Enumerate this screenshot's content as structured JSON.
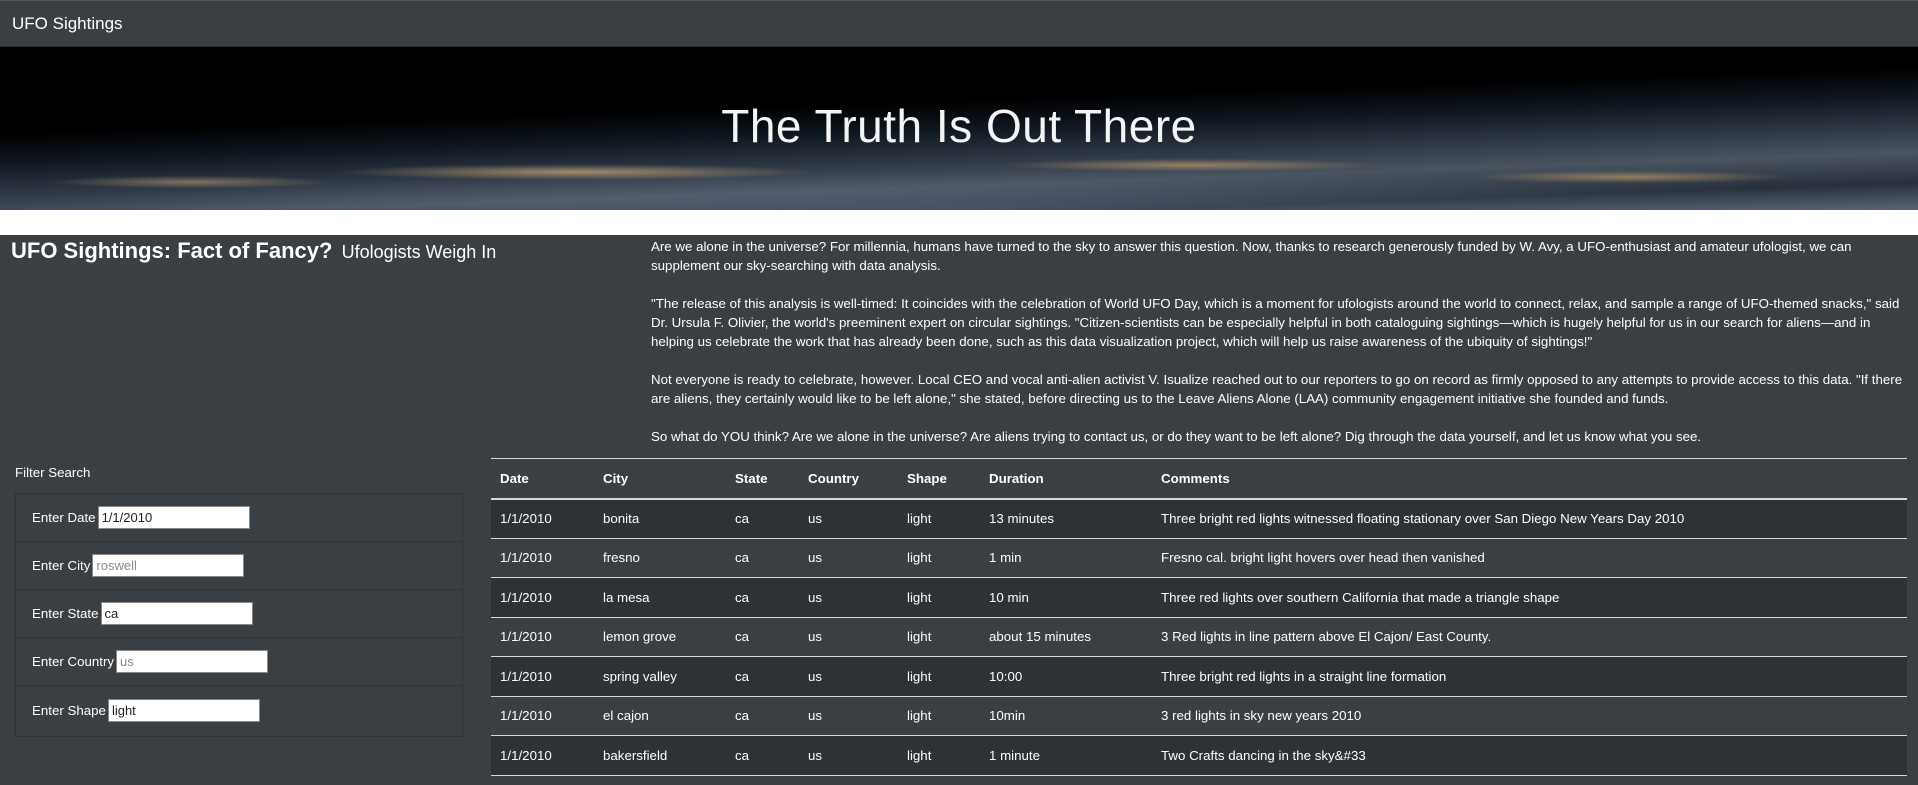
{
  "navbar": {
    "brand": "UFO Sightings"
  },
  "hero": {
    "title": "The Truth Is Out There"
  },
  "intro": {
    "heading": "UFO Sightings: Fact of Fancy?",
    "subheading": "Ufologists Weigh In",
    "paragraphs": [
      "Are we alone in the universe? For millennia, humans have turned to the sky to answer this question. Now, thanks to research generously funded by W. Avy, a UFO-enthusiast and amateur ufologist, we can supplement our sky-searching with data analysis.",
      "\"The release of this analysis is well-timed: It coincides with the celebration of World UFO Day, which is a moment for ufologists around the world to connect, relax, and sample a range of UFO-themed snacks,\" said Dr. Ursula F. Olivier, the world's preeminent expert on circular sightings. \"Citizen-scientists can be especially helpful in both cataloguing sightings—which is hugely helpful for us in our search for aliens—and in helping us celebrate the work that has already been done, such as this data visualization project, which will help us raise awareness of the ubiquity of sightings!\"",
      "Not everyone is ready to celebrate, however. Local CEO and vocal anti-alien activist V. Isualize reached out to our reporters to go on record as firmly opposed to any attempts to provide access to this data. \"If there are aliens, they certainly would like to be left alone,\" she stated, before directing us to the Leave Aliens Alone (LAA) community engagement initiative she founded and funds.",
      "So what do YOU think? Are we alone in the universe? Are aliens trying to contact us, or do they want to be left alone? Dig through the data yourself, and let us know what you see."
    ]
  },
  "filters": {
    "title": "Filter Search",
    "fields": [
      {
        "label": "Enter Date",
        "value": "1/1/2010",
        "placeholder": ""
      },
      {
        "label": "Enter City",
        "value": "",
        "placeholder": "roswell"
      },
      {
        "label": "Enter State",
        "value": "ca",
        "placeholder": ""
      },
      {
        "label": "Enter Country",
        "value": "",
        "placeholder": "us"
      },
      {
        "label": "Enter Shape",
        "value": "light",
        "placeholder": ""
      }
    ]
  },
  "table": {
    "columns": [
      "Date",
      "City",
      "State",
      "Country",
      "Shape",
      "Duration",
      "Comments"
    ],
    "rows": [
      [
        "1/1/2010",
        "bonita",
        "ca",
        "us",
        "light",
        "13 minutes",
        "Three bright red lights witnessed floating stationary over San Diego New Years Day 2010"
      ],
      [
        "1/1/2010",
        "fresno",
        "ca",
        "us",
        "light",
        "1 min",
        "Fresno cal. bright light hovers over head then vanished"
      ],
      [
        "1/1/2010",
        "la mesa",
        "ca",
        "us",
        "light",
        "10 min",
        "Three red lights over southern California that made a triangle shape"
      ],
      [
        "1/1/2010",
        "lemon grove",
        "ca",
        "us",
        "light",
        "about 15 minutes",
        "3 Red lights in line pattern above El Cajon/ East County."
      ],
      [
        "1/1/2010",
        "spring valley",
        "ca",
        "us",
        "light",
        "10:00",
        "Three bright red lights in a straight line formation"
      ],
      [
        "1/1/2010",
        "el cajon",
        "ca",
        "us",
        "light",
        "10min",
        "3 red lights in sky new years 2010"
      ],
      [
        "1/1/2010",
        "bakersfield",
        "ca",
        "us",
        "light",
        "1 minute",
        "Two Crafts dancing in the sky&#33"
      ]
    ]
  }
}
